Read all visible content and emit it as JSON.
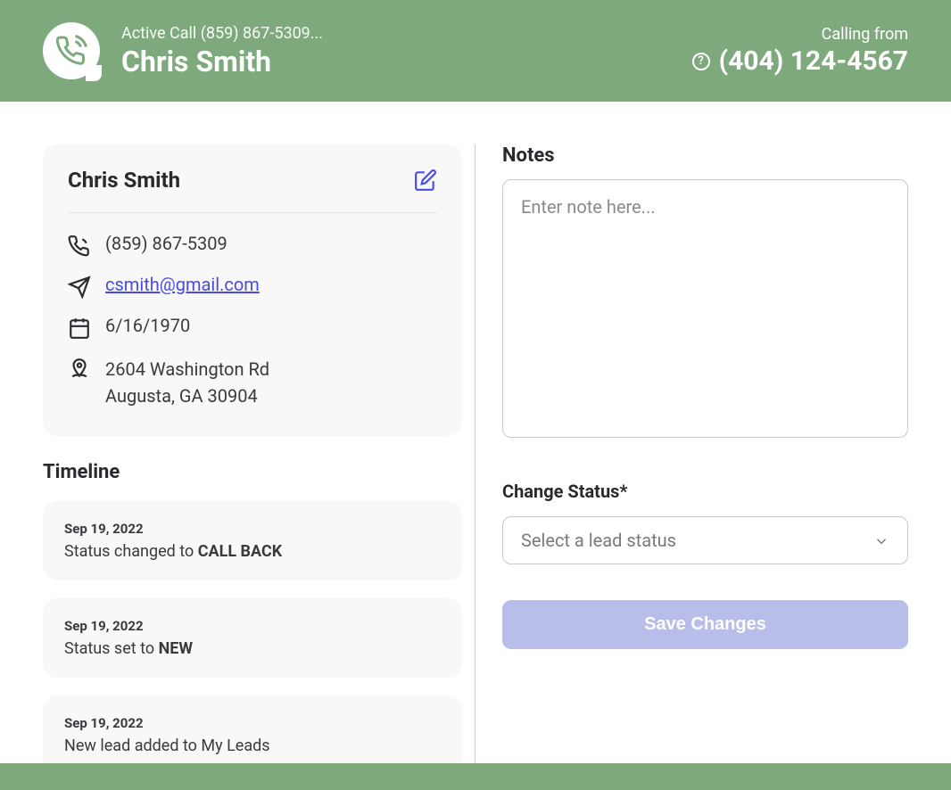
{
  "header": {
    "active_call_label": "Active Call (859) 867-5309...",
    "caller_name": "Chris Smith",
    "calling_from_label": "Calling from",
    "calling_from_number": "(404) 124-4567",
    "help_glyph": "?"
  },
  "contact": {
    "name": "Chris Smith",
    "phone": "(859) 867-5309",
    "email": "csmith@gmail.com",
    "birthdate": "6/16/1970",
    "address_line1": "2604 Washington Rd",
    "address_line2": "Augusta, GA 30904"
  },
  "timeline": {
    "title": "Timeline",
    "items": [
      {
        "date": "Sep 19, 2022",
        "prefix": "Status changed to ",
        "bold": "CALL BACK"
      },
      {
        "date": "Sep 19, 2022",
        "prefix": "Status set to ",
        "bold": "NEW"
      },
      {
        "date": "Sep 19, 2022",
        "prefix": "New lead added to My Leads",
        "bold": ""
      }
    ]
  },
  "notes": {
    "label": "Notes",
    "placeholder": "Enter note here..."
  },
  "status": {
    "label": "Change Status*",
    "placeholder": "Select a lead status"
  },
  "buttons": {
    "save": "Save Changes"
  }
}
